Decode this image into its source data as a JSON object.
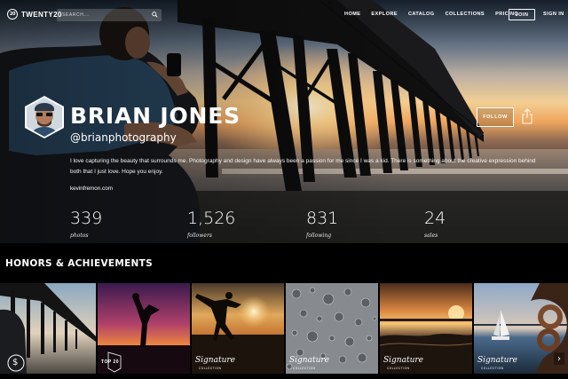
{
  "nav": {
    "logo_mark": "20",
    "logo_text": "TWENTY20",
    "search_placeholder": "SEARCH...",
    "links": [
      "HOME",
      "EXPLORE",
      "CATALOG",
      "COLLECTIONS",
      "PRICING"
    ],
    "join_label": "JOIN",
    "signin_label": "SIGN IN"
  },
  "profile": {
    "name": "BRIAN JONES",
    "handle": "@brianphotography",
    "bio": "I love capturing the beauty that surrounds me. Photography and design have always been a passion for me since I was a kid. There is something about the creative expression behind both that I just love. Hope you enjoy.",
    "website": "kevinfremon.com",
    "follow_label": "FOLLOW"
  },
  "stats": [
    {
      "value": "339",
      "label": "photos"
    },
    {
      "value": "1,526",
      "label": "followers"
    },
    {
      "value": "831",
      "label": "following"
    },
    {
      "value": "24",
      "label": "sales"
    }
  ],
  "honors": {
    "title": "HONORS & ACHIEVEMENTS",
    "badges": {
      "sales_symbol": "$",
      "top20": "TOP 20",
      "signature": "Signature",
      "signature_sub": "COLLECTION"
    }
  },
  "colors": {
    "accent": "#ffffff",
    "background": "#000000"
  }
}
